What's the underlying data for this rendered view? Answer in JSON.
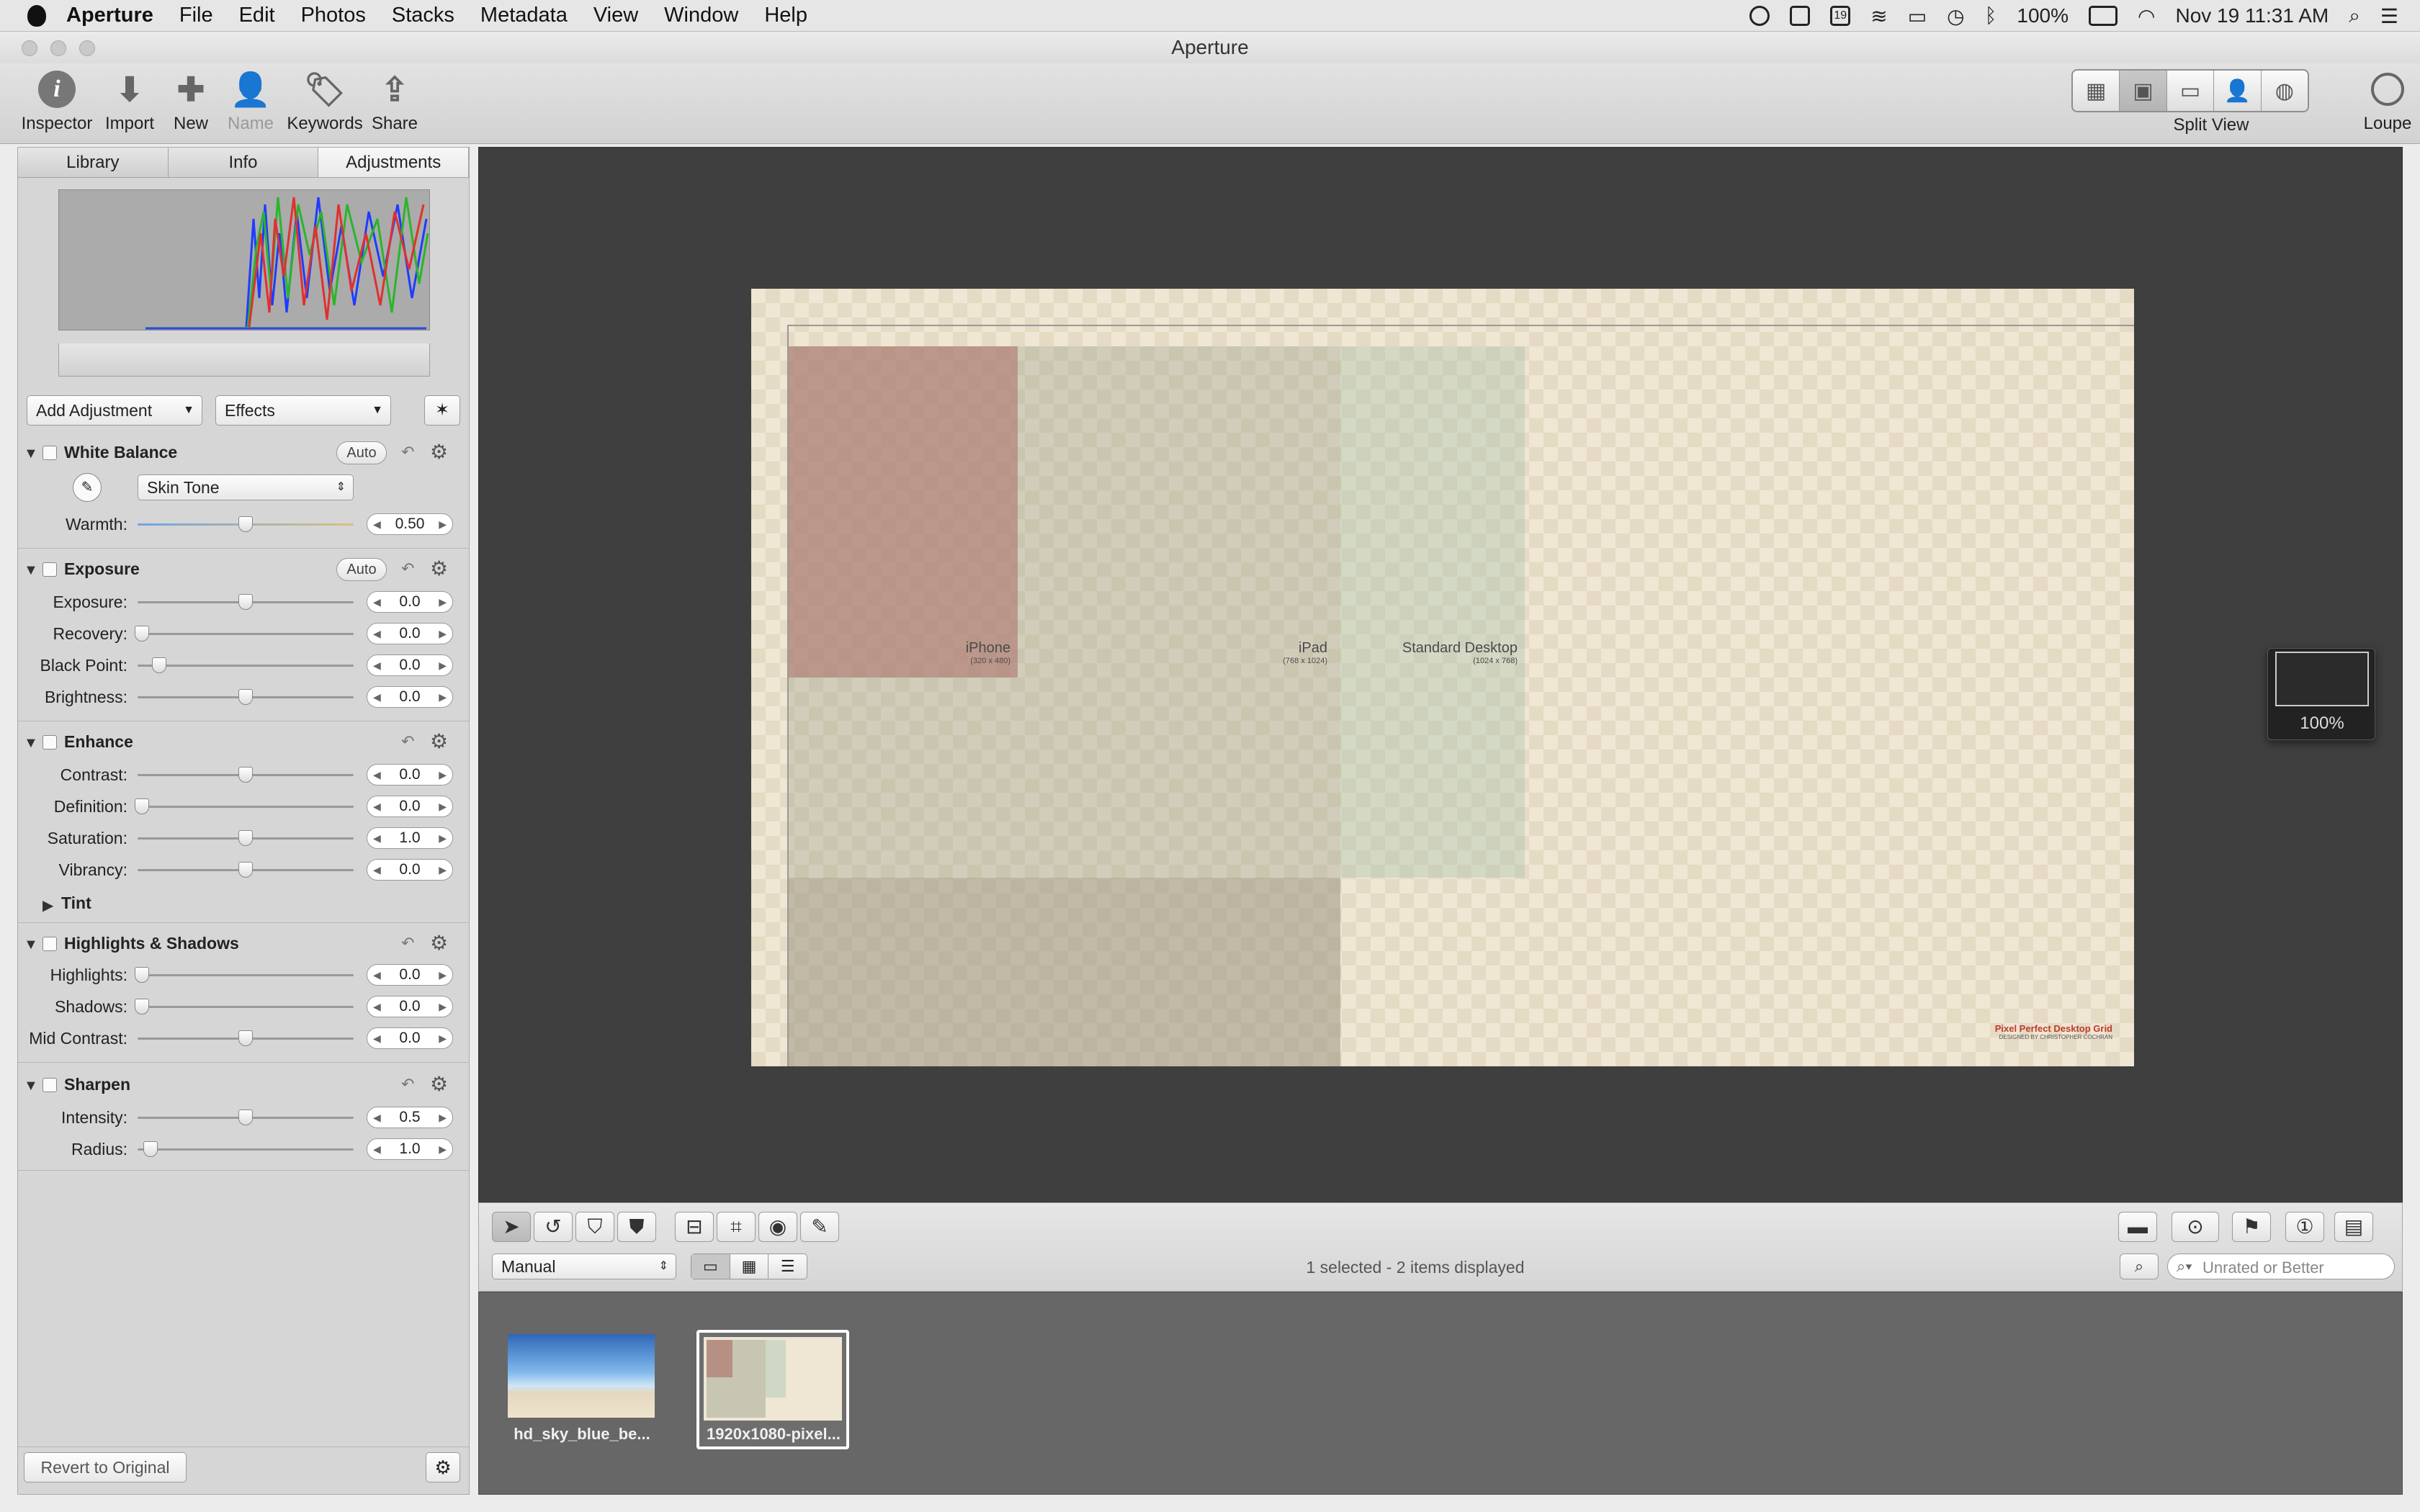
{
  "menubar": {
    "app_name": "Aperture",
    "items": [
      "File",
      "Edit",
      "Photos",
      "Stacks",
      "Metadata",
      "View",
      "Window",
      "Help"
    ],
    "battery": "100%",
    "calendar_day": "19",
    "datetime": "Nov 19  11:31 AM"
  },
  "window": {
    "title": "Aperture"
  },
  "toolbar": {
    "inspector": "Inspector",
    "import": "Import",
    "new": "New",
    "name": "Name",
    "keywords": "Keywords",
    "share": "Share",
    "split_view": "Split View",
    "loupe": "Loupe"
  },
  "inspector": {
    "tabs": [
      "Library",
      "Info",
      "Adjustments"
    ],
    "add_adjustment": "Add Adjustment",
    "effects": "Effects",
    "auto_label": "Auto",
    "white_balance": {
      "title": "White Balance",
      "mode": "Skin Tone",
      "warmth_label": "Warmth:",
      "warmth_value": "0.50"
    },
    "exposure": {
      "title": "Exposure",
      "rows": [
        {
          "label": "Exposure:",
          "value": "0.0"
        },
        {
          "label": "Recovery:",
          "value": "0.0"
        },
        {
          "label": "Black Point:",
          "value": "0.0"
        },
        {
          "label": "Brightness:",
          "value": "0.0"
        }
      ]
    },
    "enhance": {
      "title": "Enhance",
      "rows": [
        {
          "label": "Contrast:",
          "value": "0.0"
        },
        {
          "label": "Definition:",
          "value": "0.0"
        },
        {
          "label": "Saturation:",
          "value": "1.0"
        },
        {
          "label": "Vibrancy:",
          "value": "0.0"
        }
      ],
      "tint": "Tint"
    },
    "highlights_shadows": {
      "title": "Highlights & Shadows",
      "rows": [
        {
          "label": "Highlights:",
          "value": "0.0"
        },
        {
          "label": "Shadows:",
          "value": "0.0"
        },
        {
          "label": "Mid Contrast:",
          "value": "0.0"
        }
      ]
    },
    "sharpen": {
      "title": "Sharpen",
      "rows": [
        {
          "label": "Intensity:",
          "value": "0.5"
        },
        {
          "label": "Radius:",
          "value": "1.0"
        }
      ]
    },
    "revert": "Revert to Original"
  },
  "viewer": {
    "zones": [
      {
        "name": "iPhone",
        "size": "(320 x 480)"
      },
      {
        "name": "iPad",
        "size": "(768 x 1024)"
      },
      {
        "name": "Standard Desktop",
        "size": "(1024 x 768)"
      }
    ],
    "credit_title": "Pixel Perfect Desktop Grid",
    "credit_sub": "DESIGNED BY CHRISTOPHER COCHRAN",
    "zoom": "100%"
  },
  "browser": {
    "sort": "Manual",
    "status": "1 selected - 2 items displayed",
    "filter_placeholder": "Unrated or Better",
    "thumbs": [
      {
        "caption": "hd_sky_blue_be..."
      },
      {
        "caption": "1920x1080-pixel..."
      }
    ]
  }
}
